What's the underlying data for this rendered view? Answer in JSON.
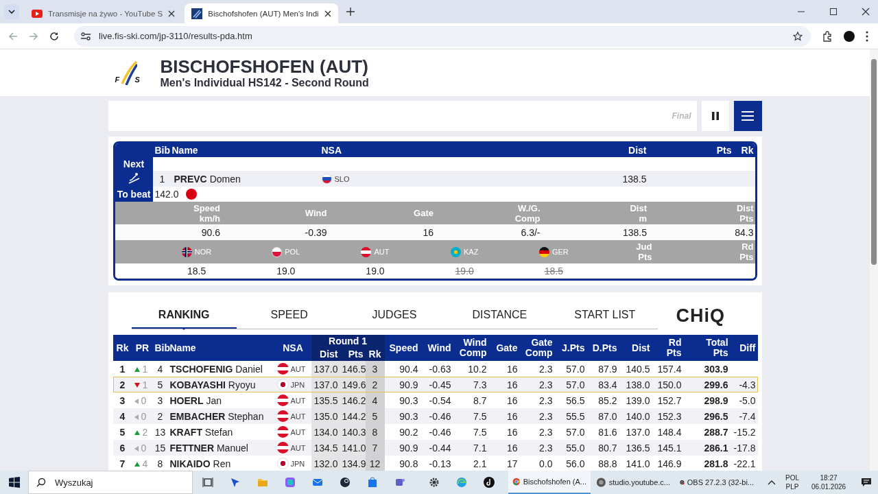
{
  "browser": {
    "tabs": [
      {
        "title": "Transmisje na żywo - YouTube S",
        "kind": "video",
        "selected": false
      },
      {
        "title": "Bischofshofen (AUT) Men's Indi",
        "kind": "ski",
        "selected": true
      }
    ],
    "url": "live.fis-ski.com/jp-3110/results-pda.htm"
  },
  "header": {
    "logo_letters": [
      "F",
      "S"
    ],
    "title": "BISCHOFSHOFEN (AUT)",
    "subtitle": "Men's Individual HS142 - Second Round"
  },
  "ticker": {
    "text": "Final"
  },
  "current": {
    "next_label": "Next",
    "to_beat_label": "To beat",
    "to_beat": "142.0",
    "columns": {
      "bib": "Bib",
      "name": "Name",
      "nsa": "NSA",
      "dist": "Dist",
      "pts": "Pts",
      "rk": "Rk"
    },
    "jumper": {
      "bib": "1",
      "last": "PREVC",
      "first": "Domen",
      "nsa": {
        "code": "SLO",
        "kind": "slo"
      },
      "dist": "138.5"
    },
    "stats": [
      {
        "label": "Speed\nkm/h",
        "value": "90.6"
      },
      {
        "label": "Wind",
        "value": "-0.39"
      },
      {
        "label": "Gate",
        "value": "16"
      },
      {
        "label": "W./G.\nComp",
        "value": "6.3/-"
      },
      {
        "label": "Dist\nm",
        "value": "138.5"
      },
      {
        "label": "Dist\nPts",
        "value": "84.3"
      }
    ],
    "judges": [
      {
        "nsa": {
          "code": "NOR",
          "kind": "nor"
        },
        "score": "18.5",
        "struck": false
      },
      {
        "nsa": {
          "code": "POL",
          "kind": "pol"
        },
        "score": "19.0",
        "struck": false
      },
      {
        "nsa": {
          "code": "AUT",
          "kind": "aut"
        },
        "score": "19.0",
        "struck": false
      },
      {
        "nsa": {
          "code": "KAZ",
          "kind": "kaz"
        },
        "score": "19.0",
        "struck": true
      },
      {
        "nsa": {
          "code": "GER",
          "kind": "ger"
        },
        "score": "18.5",
        "struck": true
      }
    ],
    "jud_pts_label": "Jud\nPts",
    "rd_pts_label": "Rd\nPts"
  },
  "ranking": {
    "tabs": [
      {
        "label": "RANKING",
        "selected": true
      },
      {
        "label": "SPEED",
        "selected": false
      },
      {
        "label": "JUDGES",
        "selected": false
      },
      {
        "label": "DISTANCE",
        "selected": false
      },
      {
        "label": "START LIST",
        "selected": false
      }
    ],
    "logo": "CHiQ",
    "columns": {
      "rk": "Rk",
      "pr": "PR",
      "bib": "Bib",
      "name": "Name",
      "nsa": "NSA",
      "round": "Round 1",
      "r1_dist": "Dist",
      "r1_pts": "Pts",
      "r1_rk": "Rk",
      "speed": "Speed",
      "wind": "Wind",
      "wind_comp": "Wind\nComp",
      "gate": "Gate",
      "gate_comp": "Gate\nComp",
      "j_pts": "J.Pts",
      "d_pts": "D.Pts",
      "dist": "Dist",
      "rd_pts": "Rd\nPts",
      "total": "Total\nPts",
      "diff": "Diff"
    },
    "rows": [
      {
        "rk": "1",
        "pr": {
          "value": "1",
          "kind": "up"
        },
        "bib": "4",
        "last": "TSCHOFENIG",
        "first": "Daniel",
        "nsa": {
          "code": "AUT",
          "kind": "aut"
        },
        "r1_dist": "137.0",
        "r1_pts": "146.5",
        "r1_rk": "3",
        "speed": "90.4",
        "wind": "-0.63",
        "wind_comp": "10.2",
        "gate": "16",
        "gate_comp": "2.3",
        "j_pts": "57.0",
        "d_pts": "87.9",
        "dist": "140.5",
        "rd_pts": "157.4",
        "total": "303.9",
        "selected": false
      },
      {
        "rk": "2",
        "pr": {
          "value": "1",
          "kind": "down"
        },
        "bib": "5",
        "last": "KOBAYASHI",
        "first": "Ryoyu",
        "nsa": {
          "code": "JPN",
          "kind": "jpn"
        },
        "r1_dist": "137.0",
        "r1_pts": "149.6",
        "r1_rk": "2",
        "speed": "90.9",
        "wind": "-0.45",
        "wind_comp": "7.3",
        "gate": "16",
        "gate_comp": "2.3",
        "j_pts": "57.0",
        "d_pts": "83.4",
        "dist": "138.0",
        "rd_pts": "150.0",
        "total": "299.6",
        "diff": "-4.3",
        "selected": true
      },
      {
        "rk": "3",
        "pr": {
          "value": "0",
          "kind": "same"
        },
        "bib": "3",
        "last": "HOERL",
        "first": "Jan",
        "nsa": {
          "code": "AUT",
          "kind": "aut"
        },
        "r1_dist": "135.5",
        "r1_pts": "146.2",
        "r1_rk": "4",
        "speed": "90.3",
        "wind": "-0.54",
        "wind_comp": "8.7",
        "gate": "16",
        "gate_comp": "2.3",
        "j_pts": "56.5",
        "d_pts": "85.2",
        "dist": "139.0",
        "rd_pts": "152.7",
        "total": "298.9",
        "diff": "-5.0",
        "selected": false
      },
      {
        "rk": "4",
        "pr": {
          "value": "0",
          "kind": "same"
        },
        "bib": "2",
        "last": "EMBACHER",
        "first": "Stephan",
        "nsa": {
          "code": "AUT",
          "kind": "aut"
        },
        "r1_dist": "135.0",
        "r1_pts": "144.2",
        "r1_rk": "5",
        "speed": "90.3",
        "wind": "-0.46",
        "wind_comp": "7.5",
        "gate": "16",
        "gate_comp": "2.3",
        "j_pts": "55.5",
        "d_pts": "87.0",
        "dist": "140.0",
        "rd_pts": "152.3",
        "total": "296.5",
        "diff": "-7.4",
        "selected": false
      },
      {
        "rk": "5",
        "pr": {
          "value": "2",
          "kind": "up"
        },
        "bib": "13",
        "last": "KRAFT",
        "first": "Stefan",
        "nsa": {
          "code": "AUT",
          "kind": "aut"
        },
        "r1_dist": "134.0",
        "r1_pts": "140.3",
        "r1_rk": "8",
        "speed": "90.2",
        "wind": "-0.46",
        "wind_comp": "7.5",
        "gate": "16",
        "gate_comp": "2.3",
        "j_pts": "57.0",
        "d_pts": "81.6",
        "dist": "137.0",
        "rd_pts": "148.4",
        "total": "288.7",
        "diff": "-15.2",
        "selected": false
      },
      {
        "rk": "6",
        "pr": {
          "value": "0",
          "kind": "same"
        },
        "bib": "15",
        "last": "FETTNER",
        "first": "Manuel",
        "nsa": {
          "code": "AUT",
          "kind": "aut"
        },
        "r1_dist": "134.5",
        "r1_pts": "141.0",
        "r1_rk": "7",
        "speed": "90.9",
        "wind": "-0.44",
        "wind_comp": "7.1",
        "gate": "16",
        "gate_comp": "2.3",
        "j_pts": "55.0",
        "d_pts": "80.7",
        "dist": "136.5",
        "rd_pts": "145.1",
        "total": "286.1",
        "diff": "-17.8",
        "selected": false
      },
      {
        "rk": "7",
        "pr": {
          "value": "4",
          "kind": "up"
        },
        "bib": "8",
        "last": "NIKAIDO",
        "first": "Ren",
        "nsa": {
          "code": "JPN",
          "kind": "jpn"
        },
        "r1_dist": "132.0",
        "r1_pts": "134.9",
        "r1_rk": "12",
        "speed": "90.8",
        "wind": "-0.13",
        "wind_comp": "2.1",
        "gate": "17",
        "gate_comp": "0.0",
        "j_pts": "56.0",
        "d_pts": "88.8",
        "dist": "141.0",
        "rd_pts": "146.9",
        "total": "281.8",
        "diff": "-22.1",
        "selected": false
      }
    ]
  },
  "taskbar": {
    "search_placeholder": "Wyszukaj",
    "apps": [
      {
        "label": "Bischofshofen (A...",
        "kind": "browser",
        "selected": true
      },
      {
        "label": "studio.youtube.c...",
        "kind": "studio",
        "selected": false
      },
      {
        "label": "OBS 27.2.3 (32-bi...",
        "kind": "recorder",
        "selected": false
      }
    ],
    "lang": "POL",
    "layout": "PLP",
    "time": "18:27",
    "date": "06.01.2026"
  }
}
